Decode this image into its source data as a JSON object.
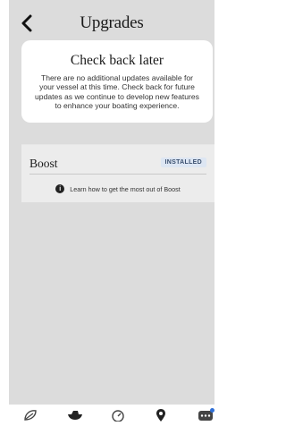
{
  "header": {
    "title": "Upgrades"
  },
  "notice": {
    "title": "Check back later",
    "body": "There are no additional updates available for\nyour vessel at this time. Check back for future\nupdates as we continue to develop new features\nto enhance your boating experience."
  },
  "upgrades": [
    {
      "name": "Boost",
      "status": "INSTALLED",
      "learn_text": "Learn how to get the most out of Boost"
    }
  ],
  "tabbar": {
    "items": [
      {
        "icon": "gauge-leaf-icon"
      },
      {
        "icon": "boat-icon"
      },
      {
        "icon": "speedometer-icon"
      },
      {
        "icon": "location-pin-icon"
      },
      {
        "icon": "more-icon"
      }
    ]
  },
  "colors": {
    "panel_bg": "#dcdcdc",
    "badge_bg": "#dde6f3",
    "notification_dot": "#2f6fd6"
  }
}
